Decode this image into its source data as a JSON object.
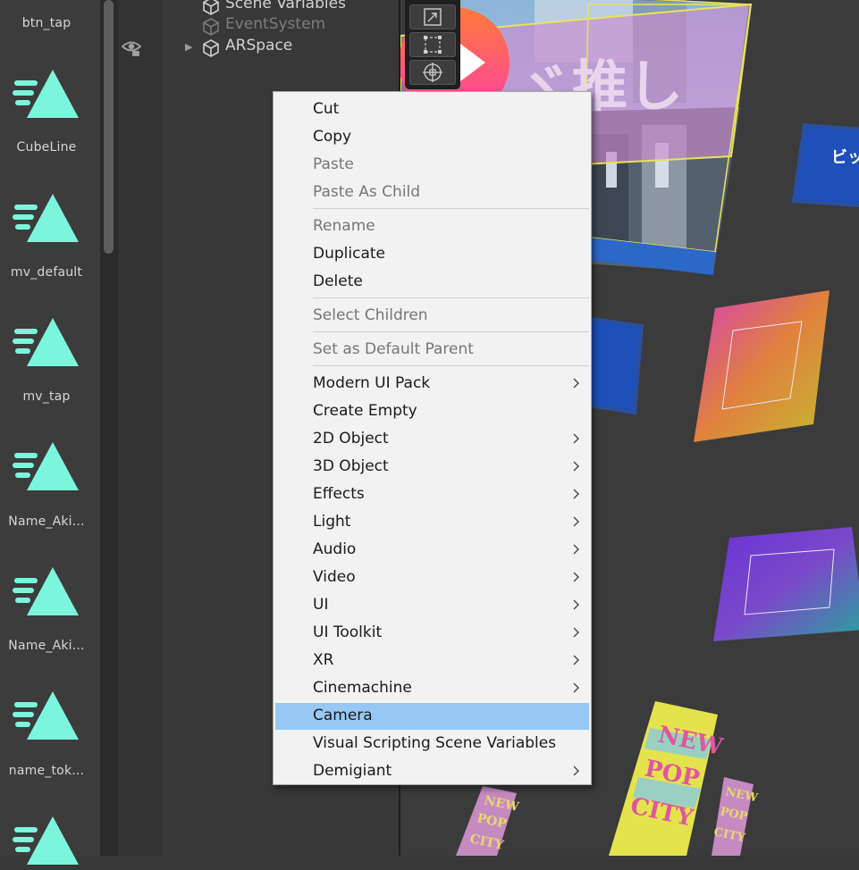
{
  "project": {
    "assets": [
      {
        "label": "btn_tap",
        "icon": "unity-timeline-icon"
      },
      {
        "label": "CubeLine",
        "icon": "unity-timeline-icon"
      },
      {
        "label": "mv_default",
        "icon": "unity-timeline-icon"
      },
      {
        "label": "mv_tap",
        "icon": "unity-timeline-icon"
      },
      {
        "label": "Name_Aki...",
        "icon": "unity-timeline-icon"
      },
      {
        "label": "Name_Aki...",
        "icon": "unity-timeline-icon"
      },
      {
        "label": "name_tok...",
        "icon": "unity-timeline-icon"
      },
      {
        "label": "",
        "icon": "unity-timeline-icon"
      }
    ],
    "icon_color": "#7cf5dd"
  },
  "hierarchy": {
    "items": [
      {
        "label": "Scene Variables",
        "enabled": true
      },
      {
        "label": "EventSystem",
        "enabled": false
      },
      {
        "label": "ARSpace",
        "enabled": true,
        "has_children": true
      }
    ]
  },
  "scene": {
    "texts": {
      "katakana": "ビッ",
      "oshi": "ヾ推し",
      "new": "NEW",
      "pop": "POP",
      "city": "CITY"
    }
  },
  "context_menu": {
    "highlight_color": "#97c8f3",
    "items": [
      {
        "label": "Cut",
        "enabled": true,
        "submenu": false
      },
      {
        "label": "Copy",
        "enabled": true,
        "submenu": false
      },
      {
        "label": "Paste",
        "enabled": false,
        "submenu": false
      },
      {
        "label": "Paste As Child",
        "enabled": false,
        "submenu": false
      },
      {
        "label": "Rename",
        "enabled": false,
        "submenu": false
      },
      {
        "label": "Duplicate",
        "enabled": true,
        "submenu": false
      },
      {
        "label": "Delete",
        "enabled": true,
        "submenu": false
      },
      {
        "label": "Select Children",
        "enabled": false,
        "submenu": false
      },
      {
        "label": "Set as Default Parent",
        "enabled": false,
        "submenu": false
      },
      {
        "label": "Modern UI Pack",
        "enabled": true,
        "submenu": true
      },
      {
        "label": "Create Empty",
        "enabled": true,
        "submenu": false
      },
      {
        "label": "2D Object",
        "enabled": true,
        "submenu": true
      },
      {
        "label": "3D Object",
        "enabled": true,
        "submenu": true
      },
      {
        "label": "Effects",
        "enabled": true,
        "submenu": true
      },
      {
        "label": "Light",
        "enabled": true,
        "submenu": true
      },
      {
        "label": "Audio",
        "enabled": true,
        "submenu": true
      },
      {
        "label": "Video",
        "enabled": true,
        "submenu": true
      },
      {
        "label": "UI",
        "enabled": true,
        "submenu": true
      },
      {
        "label": "UI Toolkit",
        "enabled": true,
        "submenu": true
      },
      {
        "label": "XR",
        "enabled": true,
        "submenu": true
      },
      {
        "label": "Cinemachine",
        "enabled": true,
        "submenu": true
      },
      {
        "label": "Camera",
        "enabled": true,
        "submenu": false,
        "highlighted": true
      },
      {
        "label": "Visual Scripting Scene Variables",
        "enabled": true,
        "submenu": false
      },
      {
        "label": "Demigiant",
        "enabled": true,
        "submenu": true
      }
    ]
  }
}
